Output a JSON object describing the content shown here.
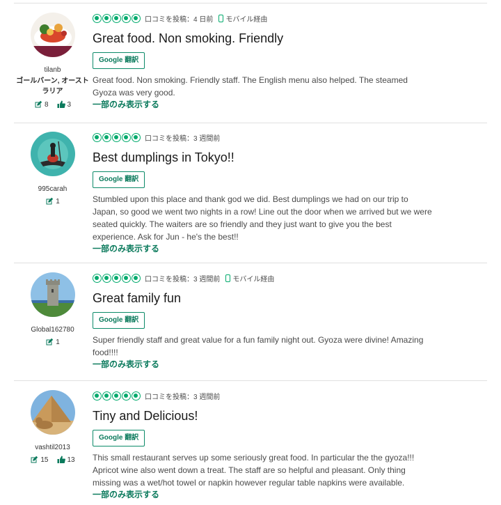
{
  "colors": {
    "accent": "#00aa6c",
    "link": "#0b7a5c",
    "divider": "#e0e0e0"
  },
  "common": {
    "rating": 5,
    "translate_label": "Google 翻訳",
    "more_label": "一部のみ表示する",
    "mobile_label": "モバイル経由",
    "icons": {
      "review_count": "review-count-icon",
      "helpful": "thumbs-up-icon",
      "mobile": "mobile-phone-icon",
      "rating": "rating-bubble-icon"
    }
  },
  "reviews": [
    {
      "username": "tilanb",
      "location": "ゴールバーン, オーストラリア",
      "review_count": "8",
      "helpful_count": "3",
      "posted": "口コミを投稿：4 日前",
      "via_mobile": true,
      "title": "Great food. Non smoking. Friendly",
      "body": "Great food. Non smoking. Friendly staff. The English menu also helped. The steamed Gyoza was very good."
    },
    {
      "username": "995carah",
      "location": "",
      "review_count": "1",
      "helpful_count": "",
      "posted": "口コミを投稿：3 週間前",
      "via_mobile": false,
      "title": "Best dumplings in Tokyo!!",
      "body": "Stumbled upon this place and thank god we did. Best dumplings we had on our trip to Japan, so good we went two nights in a row! Line out the door when we arrived but we were seated quickly. The waiters are so friendly and they just want to give you the best experience. Ask for Jun - he's the best!!"
    },
    {
      "username": "Global162780",
      "location": "",
      "review_count": "1",
      "helpful_count": "",
      "posted": "口コミを投稿：3 週間前",
      "via_mobile": true,
      "title": "Great family fun",
      "body": "Super friendly staff and great value for a fun family night out. Gyoza were divine! Amazing food!!!!"
    },
    {
      "username": "vashtil2013",
      "location": "",
      "review_count": "15",
      "helpful_count": "13",
      "posted": "口コミを投稿：3 週間前",
      "via_mobile": false,
      "title": "Tiny and Delicious!",
      "body": "This small restaurant serves up some seriously great food. In particular the the gyoza!!! Apricot wine also went down a treat. The staff are so helpful and pleasant. Only thing missing was a wet/hot towel or napkin however regular table napkins were available."
    }
  ]
}
